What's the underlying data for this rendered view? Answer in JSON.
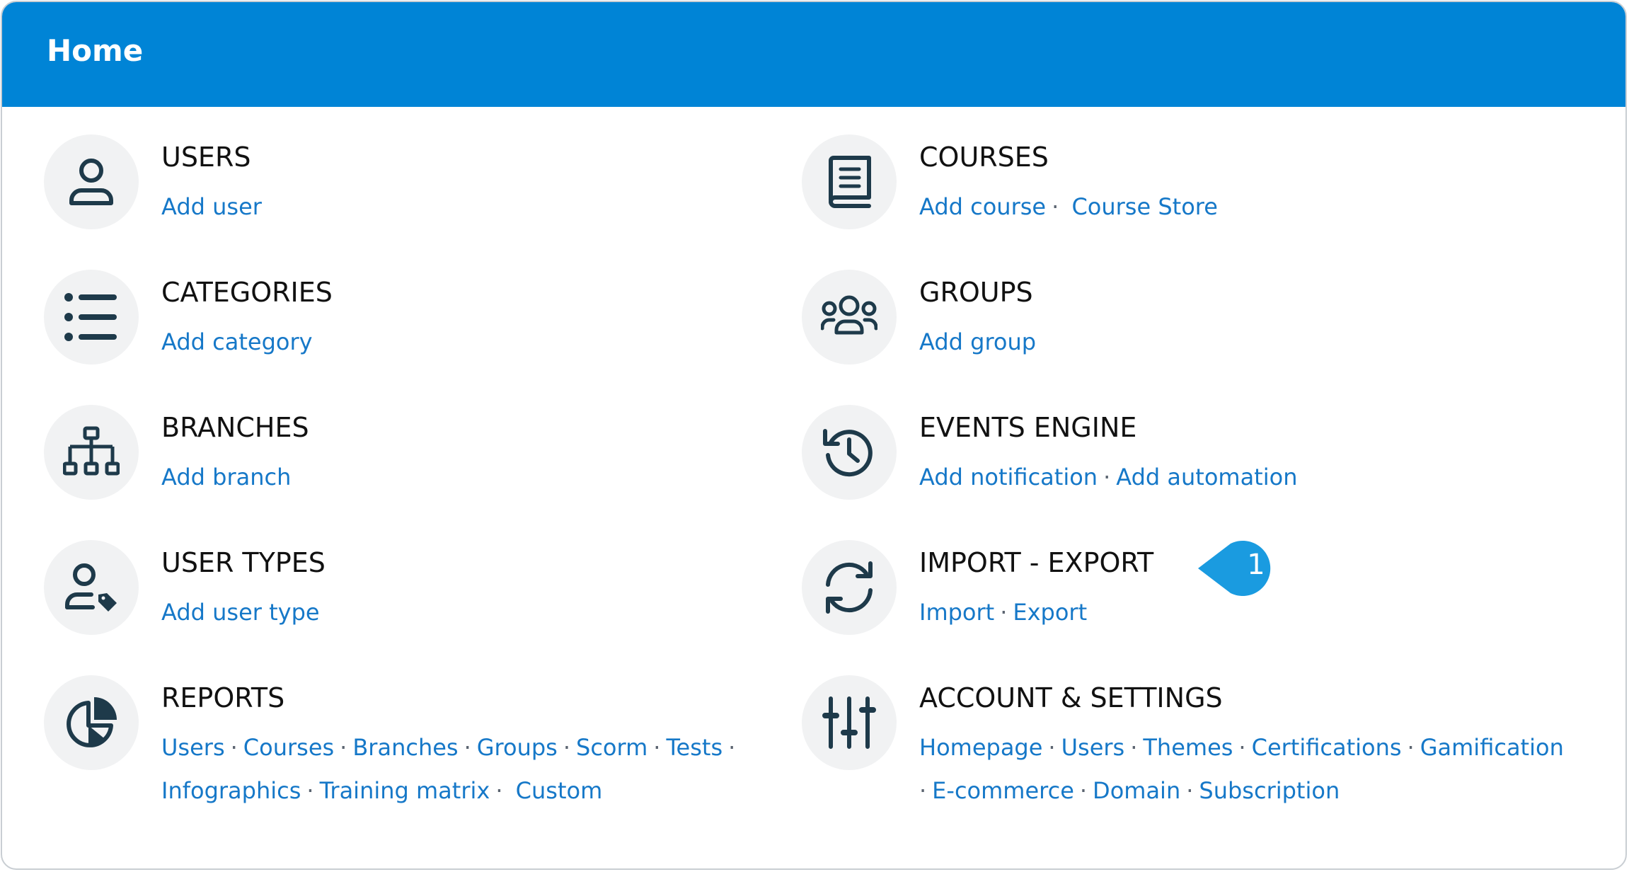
{
  "header": {
    "title": "Home"
  },
  "cards": {
    "users": {
      "title": "USERS",
      "links": [
        "Add user"
      ]
    },
    "categories": {
      "title": "CATEGORIES",
      "links": [
        "Add category"
      ]
    },
    "branches": {
      "title": "BRANCHES",
      "links": [
        "Add branch"
      ]
    },
    "user_types": {
      "title": "USER TYPES",
      "links": [
        "Add user type"
      ]
    },
    "reports": {
      "title": "REPORTS",
      "links": [
        "Users",
        "Courses",
        "Branches",
        "Groups",
        "Scorm",
        "Tests",
        "Infographics",
        "Training matrix",
        "Custom"
      ]
    },
    "courses": {
      "title": "COURSES",
      "links": [
        "Add course",
        "Course Store"
      ]
    },
    "groups": {
      "title": "GROUPS",
      "links": [
        "Add group"
      ]
    },
    "events_engine": {
      "title": "EVENTS ENGINE",
      "links": [
        "Add notification",
        "Add automation"
      ]
    },
    "import_export": {
      "title": "IMPORT - EXPORT",
      "links": [
        "Import",
        "Export"
      ]
    },
    "account_settings": {
      "title": "ACCOUNT & SETTINGS",
      "links": [
        "Homepage",
        "Users",
        "Themes",
        "Certifications",
        "Gamification",
        "E-commerce",
        "Domain",
        "Subscription"
      ]
    }
  },
  "callout": {
    "number": "1",
    "color": "#1a9be0"
  },
  "colors": {
    "header": "#0084d6",
    "link": "#1678c8",
    "icon": "#1e3a4a",
    "icon_bg": "#f1f2f3"
  }
}
